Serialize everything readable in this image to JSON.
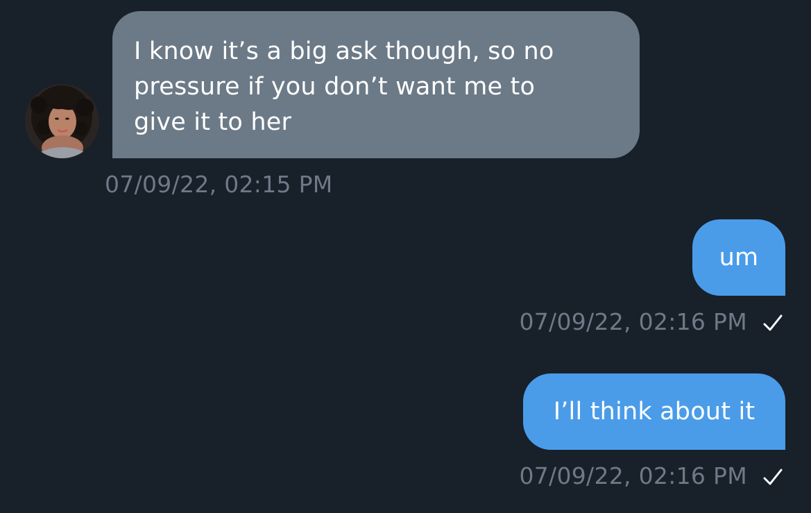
{
  "conversation": {
    "messages": [
      {
        "direction": "incoming",
        "lines": [
          "I know it’s a big ask though, so no",
          "pressure if you don’t want me to",
          "give it to her"
        ],
        "timestamp": "07/09/22, 02:15 PM"
      },
      {
        "direction": "outgoing",
        "text": "um",
        "timestamp": "07/09/22, 02:16 PM",
        "status_icon": "checkmark-icon"
      },
      {
        "direction": "outgoing",
        "text": "I’ll think about it",
        "timestamp": "07/09/22, 02:16 PM",
        "status_icon": "checkmark-icon"
      }
    ]
  },
  "colors": {
    "background": "#18202a",
    "incoming_bubble": "#6c7a87",
    "outgoing_bubble": "#4a9ce9",
    "timestamp": "#6e7a87",
    "text": "#ffffff"
  }
}
